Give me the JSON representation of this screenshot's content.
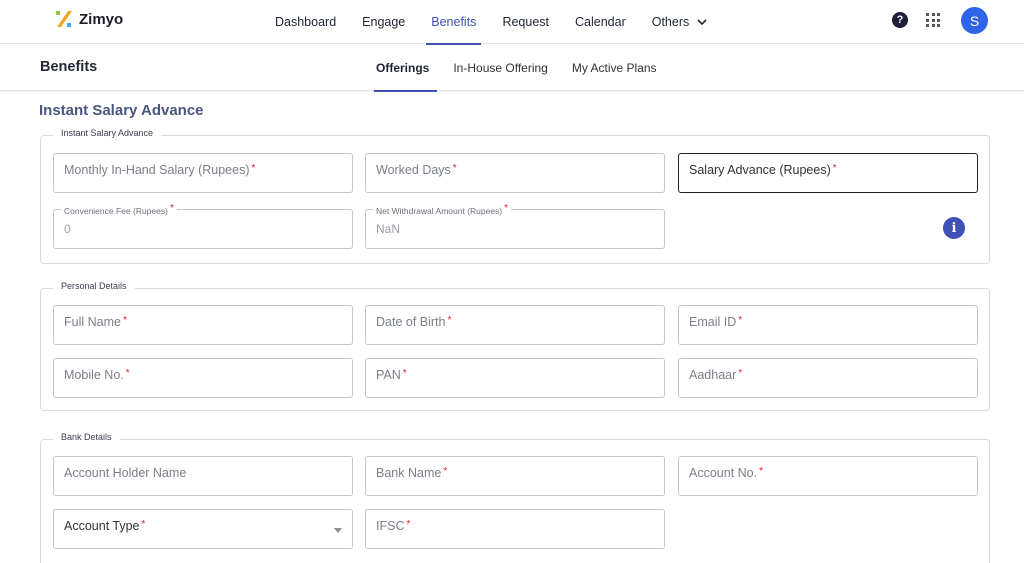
{
  "app": {
    "brand": "Zimyo"
  },
  "nav": {
    "items": [
      "Dashboard",
      "Engage",
      "Benefits",
      "Request",
      "Calendar",
      "Others"
    ],
    "active": "Benefits"
  },
  "header_icons": {
    "help": "?",
    "apps": "grid-icon",
    "avatar_initial": "S"
  },
  "subheader": {
    "title": "Benefits",
    "tabs": [
      "Offerings",
      "In-House Offering",
      "My Active Plans"
    ],
    "active_tab": "Offerings"
  },
  "page_heading": "Instant Salary Advance",
  "sections": {
    "salary": {
      "legend": "Instant Salary Advance",
      "monthly_salary": "Monthly In-Hand Salary (Rupees)",
      "worked_days": "Worked Days",
      "salary_advance": "Salary Advance (Rupees)",
      "convenience_fee_label": "Convenience Fee (Rupees)",
      "convenience_fee_value": "0",
      "net_withdrawal_label": "Net Withdrawal Amount (Rupees)",
      "net_withdrawal_value": "NaN",
      "info": "i"
    },
    "personal": {
      "legend": "Personal Details",
      "full_name": "Full Name",
      "dob": "Date of Birth",
      "email": "Email ID",
      "mobile": "Mobile No.",
      "pan": "PAN",
      "aadhaar": "Aadhaar"
    },
    "bank": {
      "legend": "Bank Details",
      "account_holder": "Account Holder Name",
      "bank_name": "Bank Name",
      "account_no": "Account No.",
      "account_type": "Account Type",
      "ifsc": "IFSC"
    }
  },
  "required_mark": "*",
  "colors": {
    "accent": "#3f51b5",
    "required": "#e02020",
    "avatar": "#2f63e8"
  }
}
